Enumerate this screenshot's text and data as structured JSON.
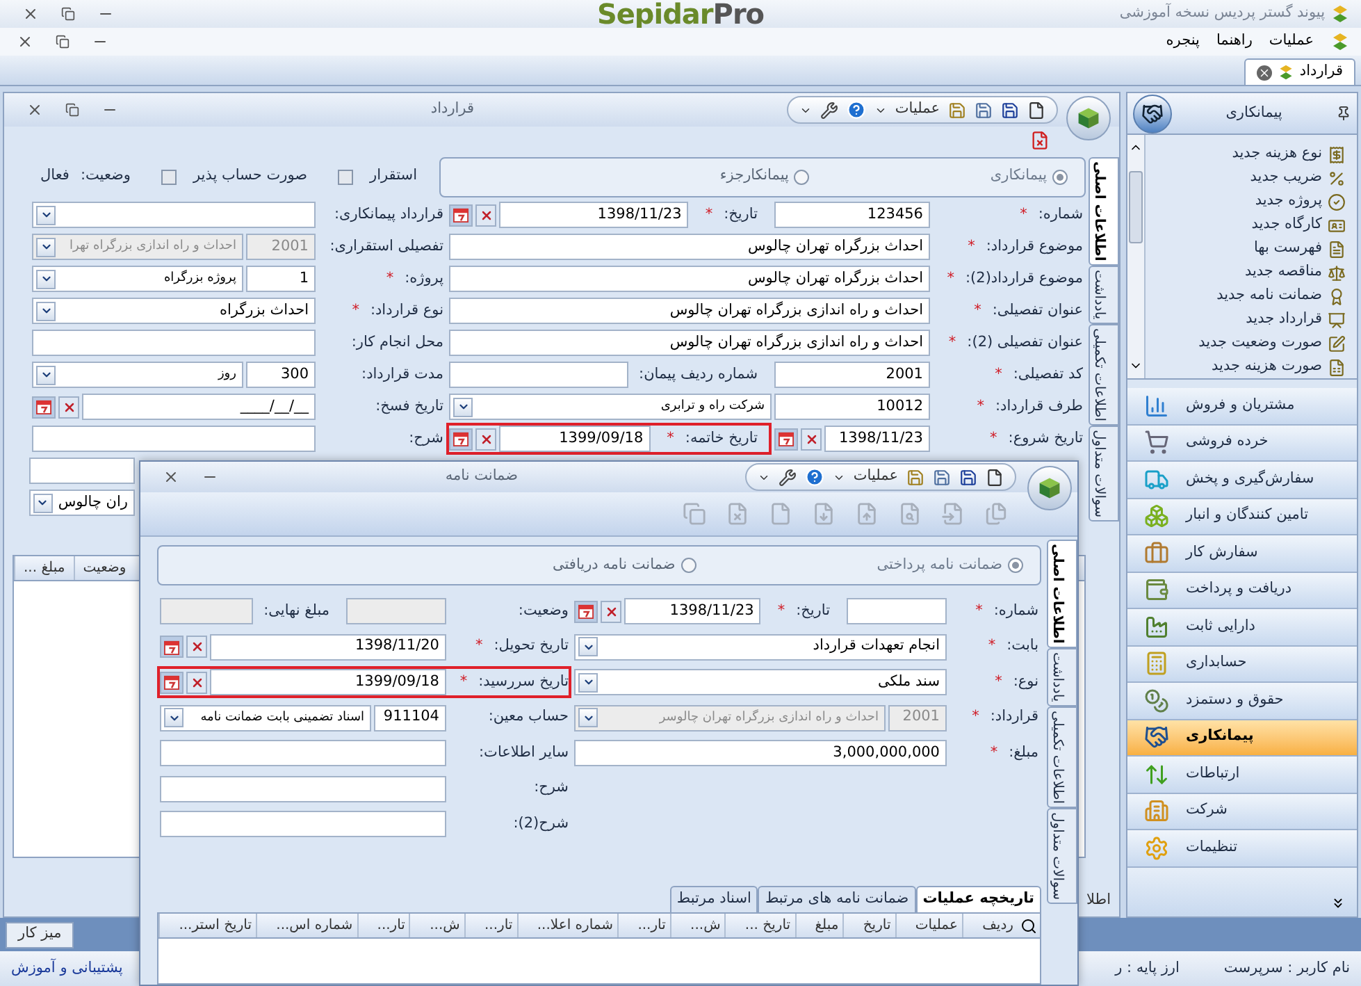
{
  "app": {
    "title": "پیوند گستر پردیس نسخه آموزشی",
    "logo": {
      "primary": "Sepidar",
      "secondary": "Pro"
    }
  },
  "menu": [
    "عملیات",
    "راهنما",
    "پنجره"
  ],
  "doc_tabs": [
    {
      "label": "قرارداد",
      "selected": true
    }
  ],
  "main_window": {
    "title": "قرارداد",
    "operations": "عملیات",
    "side_tabs": [
      {
        "label": "اطلاعات اصلی",
        "selected": true
      },
      {
        "label": "یادداشت",
        "selected": false
      },
      {
        "label": "اطلاعات تکمیلی",
        "selected": false
      },
      {
        "label": "سوالات متداول",
        "selected": false
      }
    ],
    "contract_type": [
      {
        "label": "پیمانکاری",
        "selected": true
      },
      {
        "label": "پیمانکارجزء",
        "selected": false
      }
    ],
    "checks": [
      {
        "label": "استقرار",
        "checked": false
      },
      {
        "label": "صورت حساب پذیر",
        "checked": false
      }
    ],
    "status": {
      "label": "وضعیت:",
      "value": "فعال"
    },
    "rows": [
      {
        "main": [
          {
            "kind": "text",
            "label": "شماره:",
            "mark": "*",
            "value": "123456",
            "disabled": false
          },
          {
            "kind": "date",
            "label": "تاریخ:",
            "mark": "*",
            "value": "1398/11/23",
            "disabled": false
          }
        ],
        "side": [
          {
            "kind": "combo",
            "label": "قرارداد پیمانکاری:",
            "disabled": false
          }
        ]
      },
      {
        "main": [
          {
            "kind": "text",
            "label": "موضوع قرارداد:",
            "mark": "*",
            "value": "احداث بزرگراه تهران چالوس",
            "disabled": false
          }
        ],
        "side": [
          {
            "kind": "code_combo",
            "label": "تفصیلی استقراری:",
            "code": "2001",
            "value": "احداث و راه اندازی بزرگراه تهرا",
            "disabled": true
          }
        ]
      },
      {
        "main": [
          {
            "kind": "text",
            "label": "موضوع قرارداد(2):",
            "mark": "*",
            "value": "احداث بزرگراه تهران چالوس",
            "disabled": false
          }
        ],
        "side": [
          {
            "kind": "code_combo",
            "label": "پروژه:",
            "mark": "*",
            "code": "1",
            "value": "پروژه بزرگراه",
            "disabled": false
          }
        ]
      },
      {
        "main": [
          {
            "kind": "text",
            "label": "عنوان تفصیلی:",
            "mark": "*",
            "value": "احداث و راه اندازی بزرگراه تهران چالوس",
            "disabled": false
          }
        ],
        "side": [
          {
            "kind": "combo",
            "label": "نوع قرارداد:",
            "mark": "*",
            "value": "احداث بزرگراه",
            "disabled": false
          }
        ]
      },
      {
        "main": [
          {
            "kind": "text",
            "label": "عنوان تفصیلی (2):",
            "mark": "*",
            "value": "احداث و راه اندازی بزرگراه تهران چالوس",
            "disabled": false
          }
        ],
        "side": [
          {
            "kind": "text",
            "label": "محل انجام کار:",
            "disabled": false
          }
        ]
      },
      {
        "main": [
          {
            "kind": "text",
            "label": "کد تفصیلی:",
            "mark": "*",
            "value": "2001",
            "disabled": false
          },
          {
            "kind": "text",
            "label": "شماره ردیف پیمان:",
            "disabled": false
          }
        ],
        "side": [
          {
            "kind": "code_combo",
            "label": "مدت قرارداد:",
            "code": "300",
            "value": "روز",
            "disabled": false
          }
        ]
      },
      {
        "main": [
          {
            "kind": "code_combo",
            "label": "طرف قرارداد:",
            "mark": "*",
            "code": "10012",
            "value": "شرکت راه و ترابری",
            "disabled": false
          }
        ],
        "side": [
          {
            "kind": "date",
            "label": "تاریخ فسخ:",
            "value": "____/__/__",
            "disabled": false
          }
        ]
      },
      {
        "main": [
          {
            "kind": "date",
            "label": "تاریخ شروع:",
            "mark": "*",
            "value": "1398/11/23",
            "disabled": false
          },
          {
            "kind": "date",
            "label": "تاریخ خاتمه:",
            "mark": "*",
            "value": "1399/09/18",
            "disabled": false,
            "highlighted": true
          }
        ],
        "side": [
          {
            "kind": "text",
            "label": "شرح:",
            "disabled": false
          }
        ]
      }
    ],
    "covered_fields": [
      {
        "kind": "text",
        "disabled": false
      },
      {
        "kind": "combo",
        "value": "ران چالوس",
        "disabled": false
      }
    ],
    "grid_columns": [
      "وضعیت",
      "مبلغ ..."
    ],
    "cut_label": "اطلا"
  },
  "dialog": {
    "title": "ضمانت نامه",
    "operations": "عملیات",
    "side_tabs": [
      {
        "label": "اطلاعات اصلی",
        "selected": true
      },
      {
        "label": "یادداشت",
        "selected": false
      },
      {
        "label": "اطلاعات تکمیلی",
        "selected": false
      },
      {
        "label": "سوالات متداول",
        "selected": false
      }
    ],
    "guarantee_type": [
      {
        "label": "ضمانت نامه پرداختی",
        "selected": true
      },
      {
        "label": "ضمانت نامه دریافتی",
        "selected": false
      }
    ],
    "rows": [
      {
        "main": [
          {
            "kind": "text",
            "label": "شماره:",
            "mark": "*",
            "disabled": false
          },
          {
            "kind": "date",
            "label": "تاریخ:",
            "mark": "*",
            "value": "1398/11/23",
            "disabled": false
          }
        ],
        "side": [
          {
            "kind": "text",
            "label": "وضعیت:",
            "disabled": true
          },
          {
            "kind": "text",
            "label": "مبلغ نهایی:",
            "disabled": true
          }
        ]
      },
      {
        "main": [
          {
            "kind": "combo",
            "label": "بابت:",
            "mark": "*",
            "value": "انجام تعهدات قرارداد",
            "disabled": false
          }
        ],
        "side": [
          {
            "kind": "date",
            "label": "تاریخ تحویل:",
            "mark": "*",
            "value": "1398/11/20",
            "disabled": false
          }
        ]
      },
      {
        "main": [
          {
            "kind": "combo",
            "label": "نوع:",
            "mark": "*",
            "value": "سند ملکی",
            "disabled": false
          }
        ],
        "side": [
          {
            "kind": "date",
            "label": "تاریخ سررسید:",
            "mark": "*",
            "value": "1399/09/18",
            "disabled": false,
            "highlighted": true
          }
        ]
      },
      {
        "main": [
          {
            "kind": "code_combo",
            "label": "قرارداد:",
            "mark": "*",
            "code": "2001",
            "value": "احداث و راه اندازی بزرگراه تهران چالوسر",
            "disabled": true
          }
        ],
        "side": [
          {
            "kind": "code_combo",
            "label": "حساب معین:",
            "code": "911104",
            "value": "اسناد تضمینی بابت ضمانت نامه",
            "disabled": false
          }
        ]
      },
      {
        "main": [
          {
            "kind": "text",
            "label": "مبلغ:",
            "mark": "*",
            "value": "3,000,000,000",
            "disabled": false
          }
        ],
        "side": [
          {
            "kind": "text",
            "label": "سایر اطلاعات:",
            "disabled": false
          }
        ]
      },
      {
        "side": [
          {
            "kind": "text",
            "label": "شرح:",
            "disabled": false
          }
        ]
      },
      {
        "side": [
          {
            "kind": "text",
            "label": "شرح(2):",
            "disabled": false
          }
        ]
      }
    ],
    "bottom_tabs": [
      {
        "label": "تاریخچه عملیات",
        "selected": true
      },
      {
        "label": "ضمانت نامه های مرتبط",
        "selected": false
      },
      {
        "label": "اسناد مرتبط",
        "selected": false
      }
    ],
    "grid_columns": [
      "ردیف",
      "عملیات",
      "تاریخ",
      "مبلغ",
      "تاریخ ...",
      "ش...",
      "تار...",
      "شماره اعلا...",
      "تار...",
      "ش...",
      "تار...",
      "شماره اس...",
      "تاریخ استر..."
    ]
  },
  "sidebar": {
    "title": "پیمانکاری",
    "tasks": [
      "نوع هزینه جدید",
      "ضریب جدید",
      "پروژه جدید",
      "کارگاه جدید",
      "فهرست بها",
      "مناقصه جدید",
      "ضمانت نامه جدید",
      "قرارداد جدید",
      "صورت وضعیت جدید",
      "صورت هزینه جدید"
    ],
    "modules": [
      {
        "label": "مشتریان و فروش",
        "selected": false
      },
      {
        "label": "خرده فروشی",
        "selected": false
      },
      {
        "label": "سفارش‌گیری و پخش",
        "selected": false
      },
      {
        "label": "تامین کنندگان و انبار",
        "selected": false
      },
      {
        "label": "سفارش کار",
        "selected": false
      },
      {
        "label": "دریافت و پرداخت",
        "selected": false
      },
      {
        "label": "دارایی ثابت",
        "selected": false
      },
      {
        "label": "حسابداری",
        "selected": false
      },
      {
        "label": "حقوق و دستمزد",
        "selected": false
      },
      {
        "label": "پیمانکاری",
        "selected": true
      },
      {
        "label": "ارتباطات",
        "selected": false
      },
      {
        "label": "شرکت",
        "selected": false
      },
      {
        "label": "تنظیمات",
        "selected": false
      }
    ]
  },
  "taskbar": {
    "desktop_button": "میز کار"
  },
  "status_bar": {
    "support": "پشتیبانی و آموزش",
    "currency": "ارز پایه : ر",
    "user": "نام کاربر : سرپرست"
  }
}
